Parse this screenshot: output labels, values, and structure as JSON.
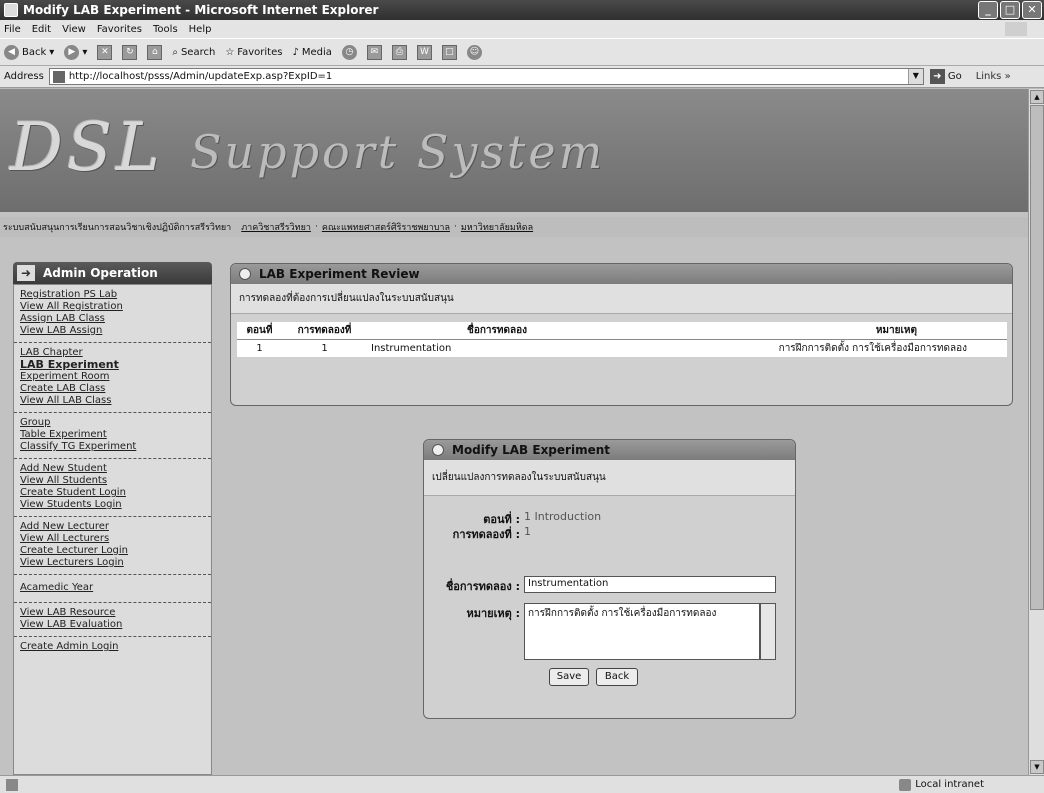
{
  "window": {
    "title": "Modify LAB Experiment - Microsoft Internet Explorer"
  },
  "menu": [
    "File",
    "Edit",
    "View",
    "Favorites",
    "Tools",
    "Help"
  ],
  "toolbar": {
    "back": "Back",
    "search": "Search",
    "favorites": "Favorites",
    "media": "Media"
  },
  "address": {
    "label": "Address",
    "url": "http://localhost/psss/Admin/updateExp.asp?ExpID=1",
    "go": "Go",
    "links": "Links"
  },
  "banner": {
    "logo_main": "DSL",
    "logo_sub": "Support System",
    "subtitle": "ระบบสนับสนุนการเรียนการสอนวิชาเชิงปฏิบัติการสรีรวิทยา",
    "links": [
      "ภาควิชาสรีรวิทยา",
      "คณะแพทยศาสตร์ศิริราชพยาบาล",
      "มหาวิทยาลัยมหิดล"
    ]
  },
  "sidebar": {
    "title": "Admin Operation",
    "groups": [
      [
        "Registration PS Lab",
        "View All Registration",
        "Assign LAB Class",
        "View LAB Assign"
      ],
      [
        "LAB Chapter",
        "LAB Experiment",
        "Experiment Room",
        "Create LAB Class",
        "View All LAB Class"
      ],
      [
        "Group",
        "Table Experiment",
        "Classify TG Experiment"
      ],
      [
        "Add New Student",
        "View All Students",
        "Create Student Login",
        "View Students Login"
      ],
      [
        "Add New Lecturer",
        "View All Lecturers",
        "Create Lecturer Login",
        "View Lecturers Login"
      ],
      [
        "Acamedic Year"
      ],
      [
        "View LAB Resource",
        "View LAB Evaluation"
      ],
      [
        "Create Admin Login"
      ]
    ]
  },
  "review": {
    "title": "LAB Experiment Review",
    "subtitle": "การทดลองที่ต้องการเปลี่ยนแปลงในระบบสนับสนุน",
    "headers": [
      "ตอนที่",
      "การทดลองที่",
      "ชื่อการทดลอง",
      "หมายเหตุ"
    ],
    "rows": [
      [
        "1",
        "1",
        "Instrumentation",
        "การฝึกการติดตั้ง การใช้เครื่องมือการทดลอง"
      ]
    ]
  },
  "modify": {
    "title": "Modify LAB Experiment",
    "subtitle": "เปลี่ยนแปลงการทดลองในระบบสนับสนุน",
    "chapter_label": "ตอนที่ :",
    "chapter_value": "1 Introduction",
    "exp_label": "การทดลองที่ :",
    "exp_value": "1",
    "name_label": "ชื่อการทดลอง :",
    "name_value": "Instrumentation",
    "note_label": "หมายเหตุ :",
    "note_value": "การฝึกการติดตั้ง การใช้เครื่องมือการทดลอง",
    "save": "Save",
    "back": "Back"
  },
  "status": {
    "zone": "Local intranet"
  }
}
